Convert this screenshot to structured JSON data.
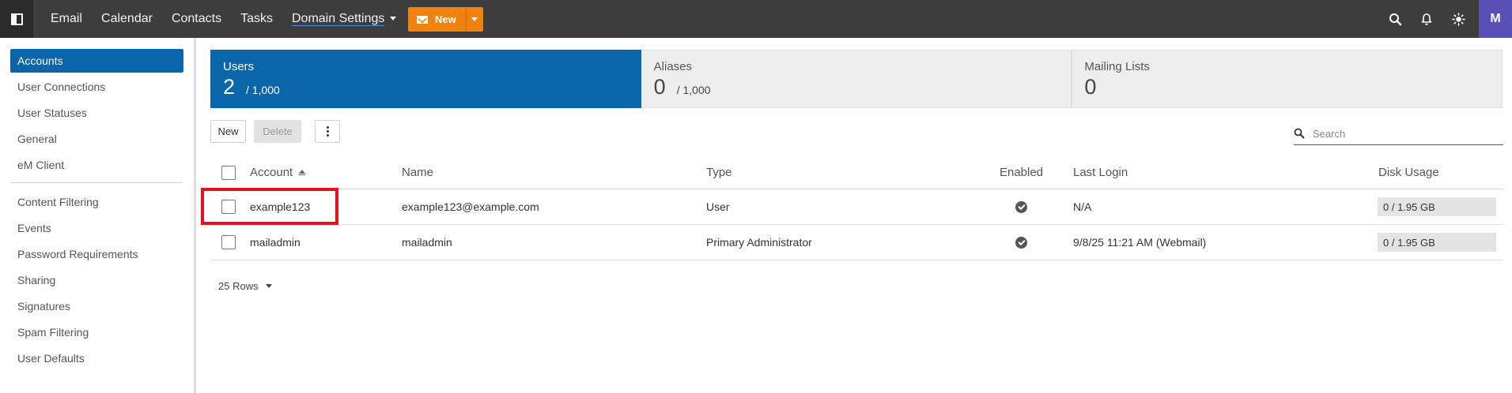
{
  "nav": {
    "items": [
      {
        "label": "Email"
      },
      {
        "label": "Calendar"
      },
      {
        "label": "Contacts"
      },
      {
        "label": "Tasks"
      },
      {
        "label": "Domain Settings"
      }
    ],
    "new_label": "New",
    "avatar_initial": "M"
  },
  "sidebar": {
    "group1": [
      {
        "label": "Accounts"
      },
      {
        "label": "User Connections"
      },
      {
        "label": "User Statuses"
      },
      {
        "label": "General"
      },
      {
        "label": "eM Client"
      }
    ],
    "group2": [
      {
        "label": "Content Filtering"
      },
      {
        "label": "Events"
      },
      {
        "label": "Password Requirements"
      },
      {
        "label": "Sharing"
      },
      {
        "label": "Signatures"
      },
      {
        "label": "Spam Filtering"
      },
      {
        "label": "User Defaults"
      }
    ]
  },
  "stats": {
    "users": {
      "label": "Users",
      "count": "2",
      "max": "/ 1,000"
    },
    "aliases": {
      "label": "Aliases",
      "count": "0",
      "max": "/ 1,000"
    },
    "mailing_lists": {
      "label": "Mailing Lists",
      "count": "0"
    }
  },
  "toolbar": {
    "new_label": "New",
    "delete_label": "Delete",
    "search_placeholder": "Search"
  },
  "table": {
    "headers": {
      "account": "Account",
      "name": "Name",
      "type": "Type",
      "enabled": "Enabled",
      "last_login": "Last Login",
      "disk_usage": "Disk Usage"
    },
    "rows": [
      {
        "account": "example123",
        "name": "example123@example.com",
        "type": "User",
        "enabled": true,
        "last_login": "N/A",
        "disk_usage": "0 / 1.95 GB"
      },
      {
        "account": "mailadmin",
        "name": "mailadmin",
        "type": "Primary Administrator",
        "enabled": true,
        "last_login": "9/8/25 11:21 AM (Webmail)",
        "disk_usage": "0 / 1.95 GB"
      }
    ]
  },
  "pagination": {
    "rows_label": "25 Rows"
  },
  "colors": {
    "accent": "#0a66a8",
    "new_button": "#f0830f",
    "topbar": "#3d3d3d",
    "highlight": "#e0141e"
  }
}
